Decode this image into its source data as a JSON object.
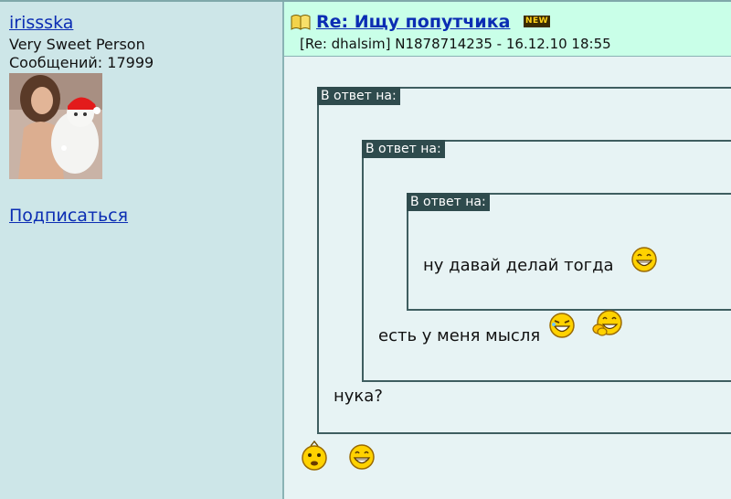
{
  "sidebar": {
    "username": "irissska",
    "user_title": "Very Sweet Person",
    "posts_label": "Сообщений:",
    "posts_count": "17999",
    "subscribe_label": "Подписаться"
  },
  "post": {
    "title": "Re: Ищу попутчика",
    "new_badge": "NEW",
    "meta": "[Re: dhalsim]  N1878714235 - 16.12.10 18:55"
  },
  "quotes": {
    "label": "В ответ на:",
    "inner_text": "ну давай делай тогда",
    "middle_text": "есть у меня мысля",
    "outer_text": "нука?"
  },
  "icons": {
    "post": "book-icon",
    "smileys": [
      "grin-smiley-icon",
      "laugh-smiley-icon",
      "clapping-smiley-icon",
      "thinking-smiley-icon",
      "grin-smiley-icon"
    ]
  },
  "colors": {
    "link": "#0b2db3",
    "quote_label_bg": "#2f4b4d",
    "header_bg": "#c9ffe8",
    "sidebar_bg": "#cde6e8",
    "new_badge_text": "#ffd21a"
  }
}
